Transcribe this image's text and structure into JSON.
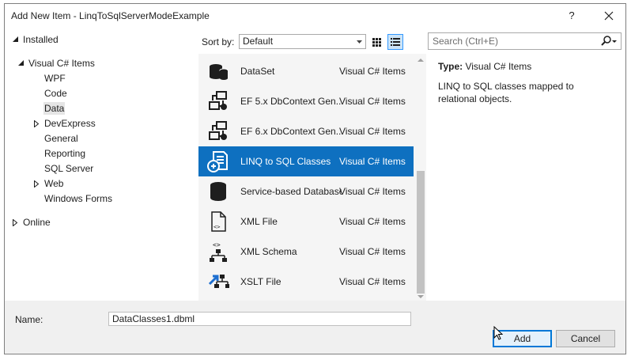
{
  "window": {
    "title": "Add New Item - LinqToSqlServerModeExample",
    "help_label": "?"
  },
  "tree": {
    "installed": "Installed",
    "visual_csharp": "Visual C# Items",
    "children": [
      "WPF",
      "Code",
      "Data",
      "DevExpress",
      "General",
      "Reporting",
      "SQL Server",
      "Web",
      "Windows Forms"
    ],
    "selected": "Data",
    "online": "Online"
  },
  "sort": {
    "label": "Sort by:",
    "value": "Default"
  },
  "search": {
    "placeholder": "Search (Ctrl+E)"
  },
  "templates": [
    {
      "name": "DataSet",
      "category": "Visual C# Items",
      "icon": "dataset-icon"
    },
    {
      "name": "EF 5.x DbContext Gen...",
      "category": "Visual C# Items",
      "icon": "ef-generator-icon"
    },
    {
      "name": "EF 6.x DbContext Gen...",
      "category": "Visual C# Items",
      "icon": "ef-generator-icon"
    },
    {
      "name": "LINQ to SQL Classes",
      "category": "Visual C# Items",
      "icon": "linq-to-sql-icon",
      "selected": true
    },
    {
      "name": "Service-based Database",
      "category": "Visual C# Items",
      "icon": "database-icon"
    },
    {
      "name": "XML File",
      "category": "Visual C# Items",
      "icon": "xml-file-icon"
    },
    {
      "name": "XML Schema",
      "category": "Visual C# Items",
      "icon": "xml-schema-icon"
    },
    {
      "name": "XSLT File",
      "category": "Visual C# Items",
      "icon": "xslt-file-icon"
    }
  ],
  "details": {
    "type_label": "Type:",
    "type_value": "Visual C# Items",
    "description": "LINQ to SQL classes mapped to relational objects."
  },
  "name_field": {
    "label": "Name:",
    "value": "DataClasses1.dbml"
  },
  "buttons": {
    "add": "Add",
    "cancel": "Cancel"
  },
  "colors": {
    "selection": "#0e70c0",
    "accent_border": "#0078d7"
  }
}
